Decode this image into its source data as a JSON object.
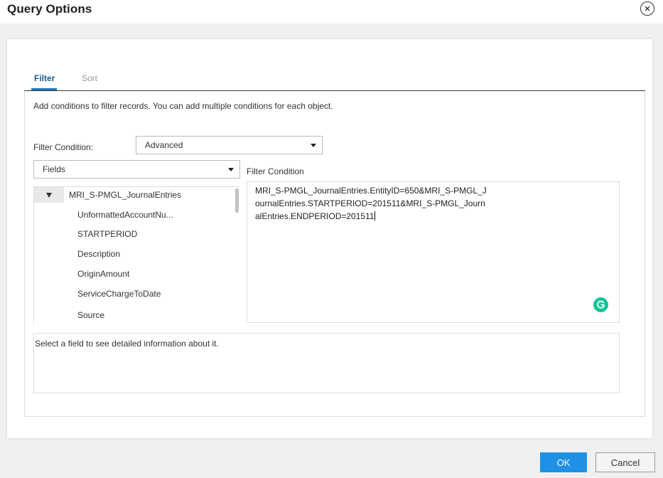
{
  "dialog": {
    "title": "Query Options"
  },
  "tabs": [
    {
      "label": "Filter",
      "active": true
    },
    {
      "label": "Sort",
      "active": false
    }
  ],
  "filter": {
    "description": "Add conditions to filter records. You can add multiple conditions for each object.",
    "condition_label": "Filter Condition:",
    "condition_mode": "Advanced",
    "fields_selector": "Fields",
    "condition_title": "Filter Condition",
    "condition_text": "MRI_S-PMGL_JournalEntries.EntityID=650&MRI_S-PMGL_JournalEntries.STARTPERIOD=201511&MRI_S-PMGL_JournalEntries.ENDPERIOD=201511",
    "info_text": "Select a field to see detailed information about it."
  },
  "tree": {
    "root": "MRI_S-PMGL_JournalEntries",
    "items": [
      "UnformattedAccountNu...",
      "STARTPERIOD",
      "Description",
      "OriginAmount",
      "ServiceChargeToDate",
      "Source"
    ]
  },
  "buttons": {
    "ok": "OK",
    "cancel": "Cancel"
  },
  "colors": {
    "primary": "#1e90e6",
    "tab_active": "#1f5a8f",
    "grammarly": "#15c39a"
  },
  "icons": {
    "close": "close-circle-icon",
    "expand": "triangle-down-icon",
    "dropdown": "caret-down-icon",
    "assistant": "grammarly-icon"
  }
}
